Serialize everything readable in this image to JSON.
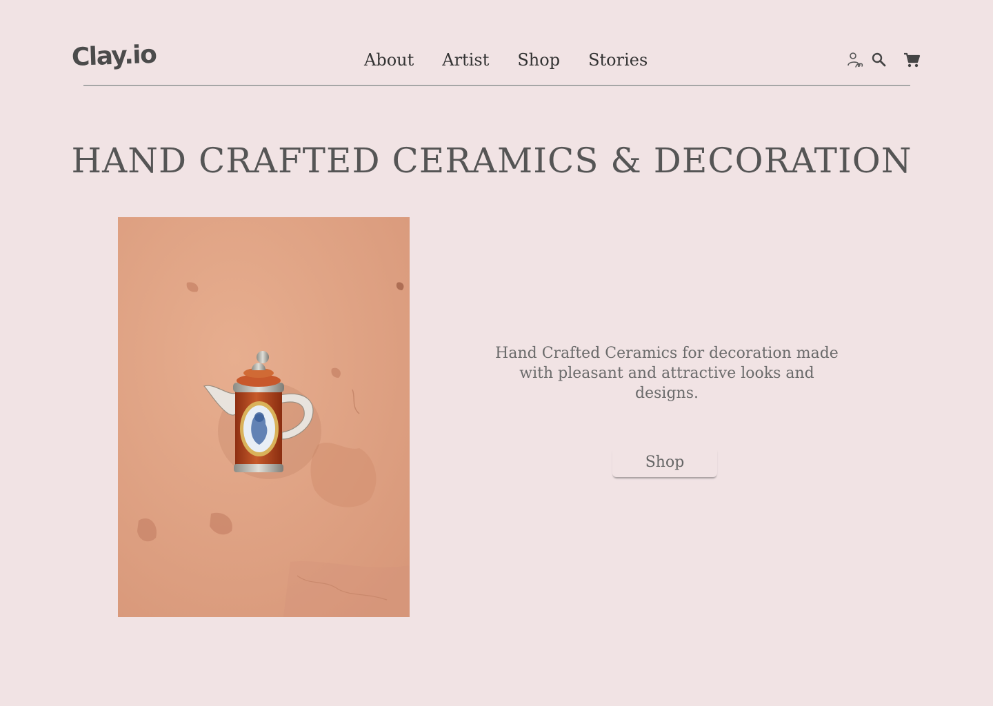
{
  "brand": {
    "logo_text": "Clay.io"
  },
  "nav": {
    "items": [
      {
        "label": "About"
      },
      {
        "label": "Artist"
      },
      {
        "label": "Shop"
      },
      {
        "label": "Stories"
      }
    ]
  },
  "header_icons": [
    {
      "icon": "account-signature-icon"
    },
    {
      "icon": "search-icon"
    },
    {
      "icon": "cart-icon"
    }
  ],
  "hero": {
    "title": "HAND CRAFTED CERAMICS & DECORATION",
    "description": "Hand Crafted Ceramics for decoration made with pleasant and attractive looks and designs.",
    "cta_label": "Shop"
  },
  "colors": {
    "background": "#f1e3e4",
    "wall": "#e0a282",
    "teapot_body": "#b54a22",
    "text": "#4a4a4a"
  }
}
